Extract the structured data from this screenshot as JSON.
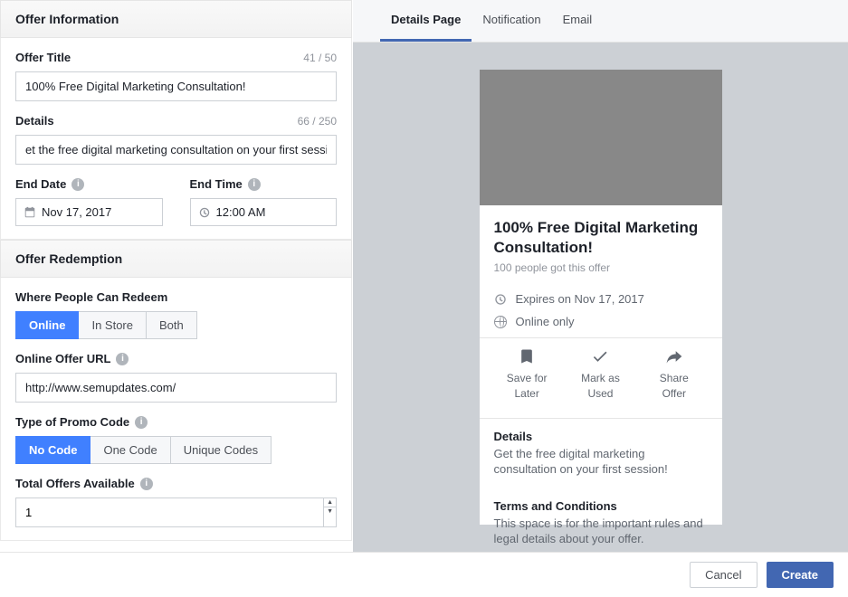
{
  "sections": {
    "info_header": "Offer Information",
    "redeem_header": "Offer Redemption"
  },
  "offer_title": {
    "label": "Offer Title",
    "counter": "41 / 50",
    "value": "100% Free Digital Marketing Consultation!"
  },
  "details": {
    "label": "Details",
    "counter": "66 / 250",
    "value": "et the free digital marketing consultation on your first session!"
  },
  "end_date": {
    "label": "End Date",
    "value": "Nov 17, 2017"
  },
  "end_time": {
    "label": "End Time",
    "value": "12:00 AM"
  },
  "redeem": {
    "where_label": "Where People Can Redeem",
    "options": {
      "online": "Online",
      "instore": "In Store",
      "both": "Both"
    },
    "url_label": "Online Offer URL",
    "url_value": "http://www.semupdates.com/",
    "promo_label": "Type of Promo Code",
    "promo_options": {
      "none": "No Code",
      "one": "One Code",
      "unique": "Unique Codes"
    },
    "total_label": "Total Offers Available",
    "total_value": "1"
  },
  "tabs": {
    "details": "Details Page",
    "notification": "Notification",
    "email": "Email"
  },
  "preview": {
    "title": "100% Free Digital Marketing Consultation!",
    "sub": "100 people got this offer",
    "expires": "Expires on Nov 17, 2017",
    "channel": "Online only",
    "actions": {
      "save": "Save for Later",
      "mark": "Mark as Used",
      "share": "Share Offer"
    },
    "details_h": "Details",
    "details_p": "Get the free digital marketing consultation on your first session!",
    "terms_h": "Terms and Conditions",
    "terms_p": "This space is for the important rules and legal details about your offer."
  },
  "footer": {
    "cancel": "Cancel",
    "create": "Create"
  }
}
